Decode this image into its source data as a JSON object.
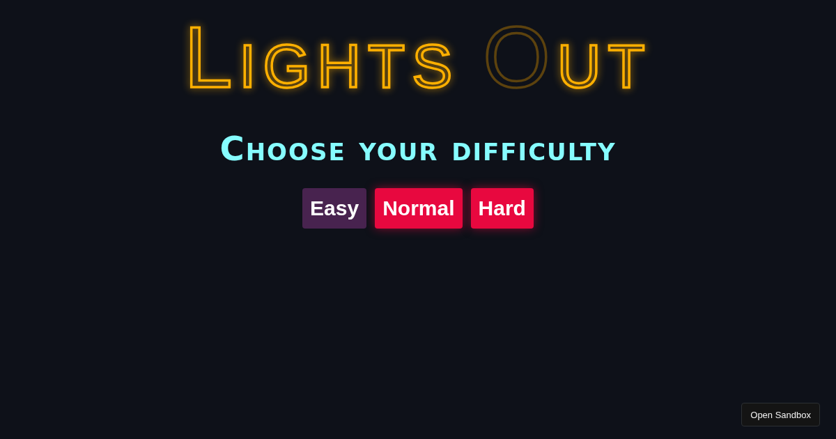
{
  "title": {
    "words": [
      {
        "parts": [
          {
            "text": "Lights",
            "lit": true
          }
        ]
      },
      {
        "parts": [
          {
            "text": "O",
            "lit": false
          },
          {
            "text": "ut",
            "lit": true
          }
        ]
      }
    ]
  },
  "heading": "Choose your difficulty",
  "difficulties": [
    {
      "label": "Easy",
      "selected": true
    },
    {
      "label": "Normal",
      "selected": false
    },
    {
      "label": "Hard",
      "selected": false
    }
  ],
  "sandbox_button": "Open Sandbox"
}
